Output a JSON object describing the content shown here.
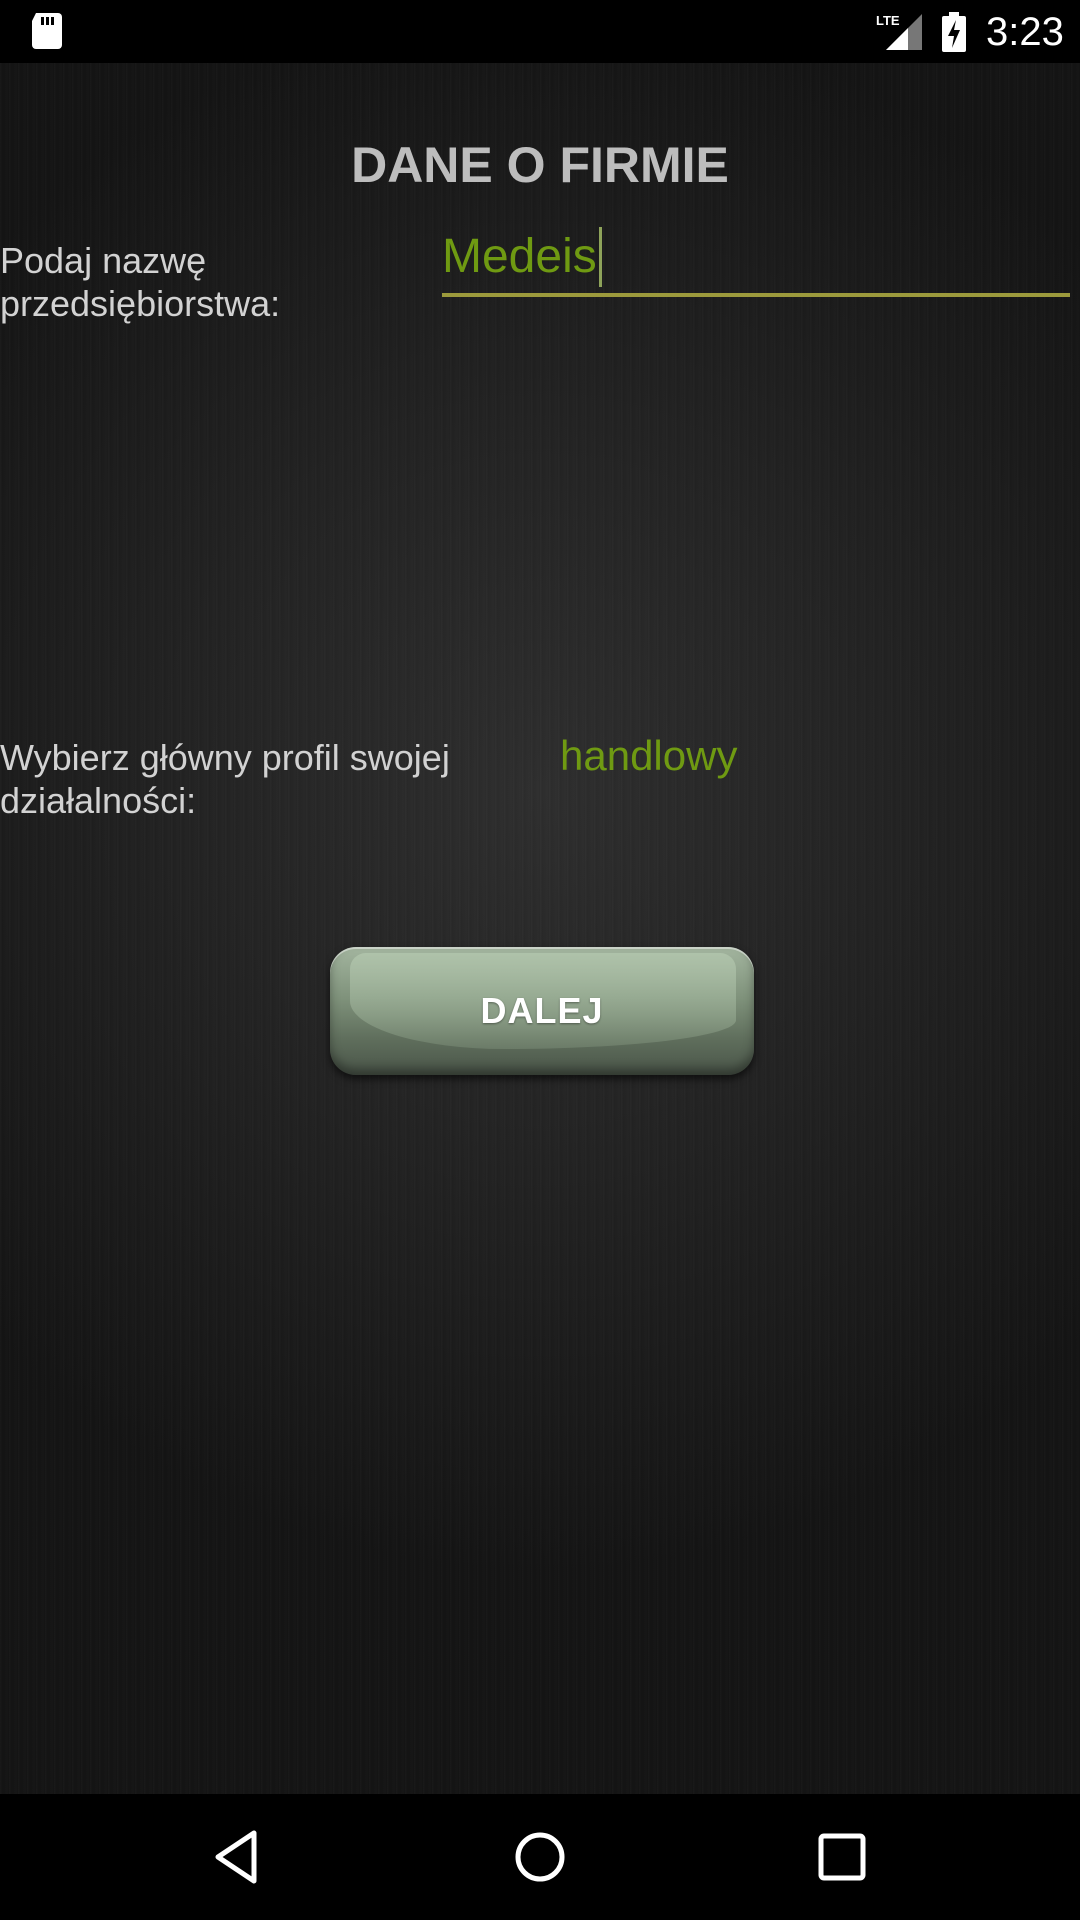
{
  "status_bar": {
    "time": "3:23",
    "network_label": "LTE",
    "icons": [
      "sd-card-icon",
      "lte-signal-icon",
      "battery-charging-icon"
    ]
  },
  "page": {
    "title": "DANE O FIRMIE"
  },
  "form": {
    "name_label": "Podaj nazwę\nprzedsiębiorstwa:",
    "name_value": "Medeis",
    "profile_label": "Wybierz główny profil swojej\ndziałalności:",
    "profile_value": "handlowy"
  },
  "actions": {
    "next_label": "DALEJ"
  },
  "nav_bar": {
    "icons": [
      "back-icon",
      "home-icon",
      "recents-icon"
    ]
  },
  "colors": {
    "accent_text": "#6f9a12",
    "field_underline": "#9c9a3c",
    "title": "#bdbdbd",
    "label": "#d2d2d2",
    "button": "#7f927b"
  }
}
